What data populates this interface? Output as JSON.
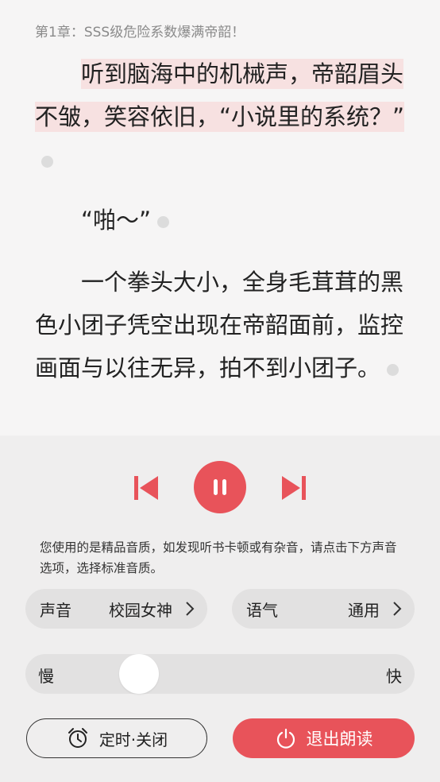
{
  "reader": {
    "chapter_title": "第1章：SSS级危险系数爆满帝韶！",
    "paragraphs": [
      {
        "text": "听到脑海中的机械声，帝韶眉头不皱，笑容依旧，“小说里的系统？”",
        "highlighted": true
      },
      {
        "text": "“啪～”",
        "highlighted": false
      },
      {
        "text": "一个拳头大小，全身毛茸茸的黑色小团子凭空出现在帝韶面前，监控画面与以往无异，拍不到小团子。",
        "highlighted": false
      }
    ]
  },
  "player": {
    "notice": "您使用的是精品音质，如发现听书卡顿或有杂音，请点击下方声音选项，选择标准音质。",
    "voice": {
      "label": "声音",
      "value": "校园女神"
    },
    "tone": {
      "label": "语气",
      "value": "通用"
    },
    "speed": {
      "slow_label": "慢",
      "fast_label": "快",
      "level": 0.15
    },
    "timer_label": "定时·关闭",
    "exit_label": "退出朗读"
  },
  "icons": {
    "prev": "skip-previous-icon",
    "pause": "pause-icon",
    "next": "skip-next-icon",
    "voice_chevron": "chevron-right-icon",
    "tone_chevron": "chevron-right-icon",
    "alarm": "alarm-clock-icon",
    "power": "power-icon"
  },
  "colors": {
    "accent": "#e8535a",
    "highlight": "#f7e1e1",
    "panel_bg": "#efeeee",
    "page_bg": "#f6f5f5"
  }
}
